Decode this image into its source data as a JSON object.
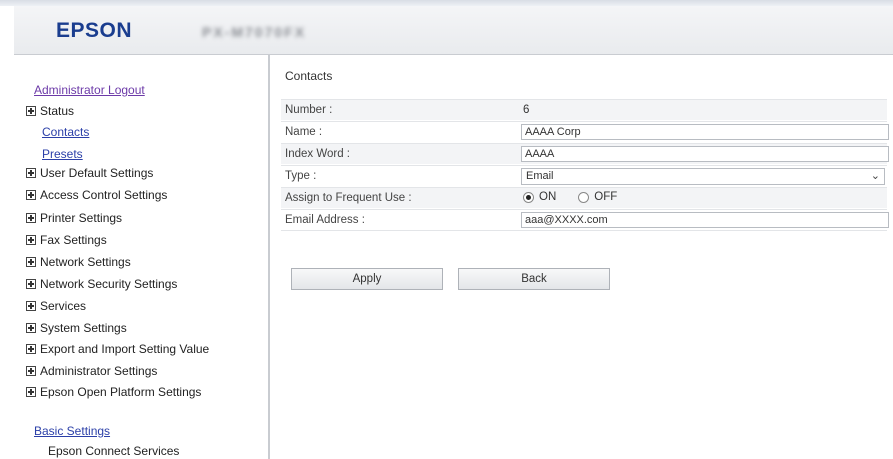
{
  "header": {
    "brand": "EPSON",
    "model": "PX-M7070FX"
  },
  "sidebar": {
    "logout": "Administrator Logout",
    "status": "Status",
    "contacts": "Contacts",
    "presets": "Presets",
    "groups": [
      "User Default Settings",
      "Access Control Settings",
      "Printer Settings",
      "Fax Settings",
      "Network Settings",
      "Network Security Settings",
      "Services",
      "System Settings",
      "Export and Import Setting Value",
      "Administrator Settings",
      "Epson Open Platform Settings"
    ],
    "basic_settings": "Basic Settings",
    "epson_connect": "Epson Connect Services"
  },
  "main": {
    "title": "Contacts",
    "number_label": "Number :",
    "number_value": "6",
    "name_label": "Name :",
    "name_value": "AAAA Corp",
    "index_label": "Index Word :",
    "index_value": "AAAA",
    "type_label": "Type :",
    "type_value": "Email",
    "frequent_label": "Assign to Frequent Use :",
    "frequent_on": "ON",
    "frequent_off": "OFF",
    "frequent_selected": "ON",
    "email_label": "Email Address :",
    "email_value": "aaa@XXXX.com",
    "apply": "Apply",
    "back": "Back"
  }
}
